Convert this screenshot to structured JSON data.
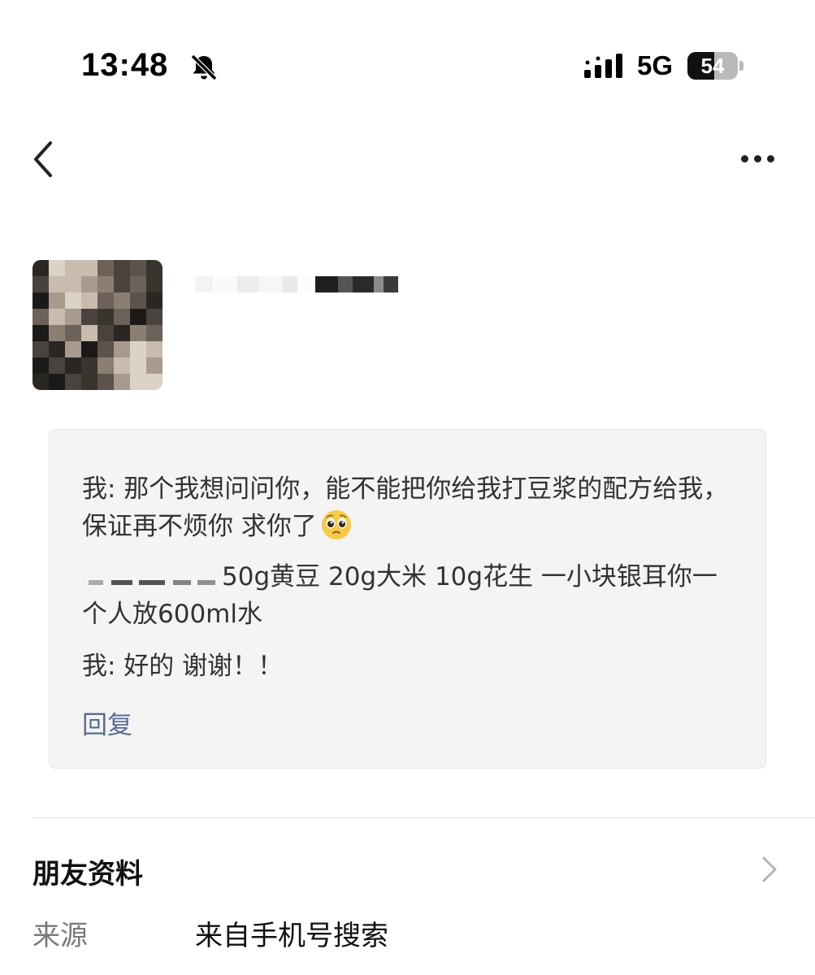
{
  "status_bar": {
    "time": "13:48",
    "network": "5G",
    "battery_percent": 54,
    "battery_text": "54"
  },
  "nav": {
    "back_icon": "chevron-left-icon",
    "more_icon": "more-horizontal-icon"
  },
  "profile": {
    "avatar_icon": "pixelated-avatar"
  },
  "message": {
    "line1_text": "我: 那个我想问问你，能不能把你给我打豆浆的配方给我，保证再不烦你 求你了",
    "line1_emoji": "pleading-face-emoji",
    "line2_text": "50g黄豆 20g大米 10g花生 一小块银耳你一个人放600ml水",
    "line3_text": "我: 好的 谢谢！！",
    "reply_label": "回复"
  },
  "friend_info": {
    "title": "朋友资料",
    "source_label": "来源",
    "source_value": "来自手机号搜索"
  },
  "colors": {
    "link": "#576b95",
    "card_bg": "#f4f4f4"
  }
}
